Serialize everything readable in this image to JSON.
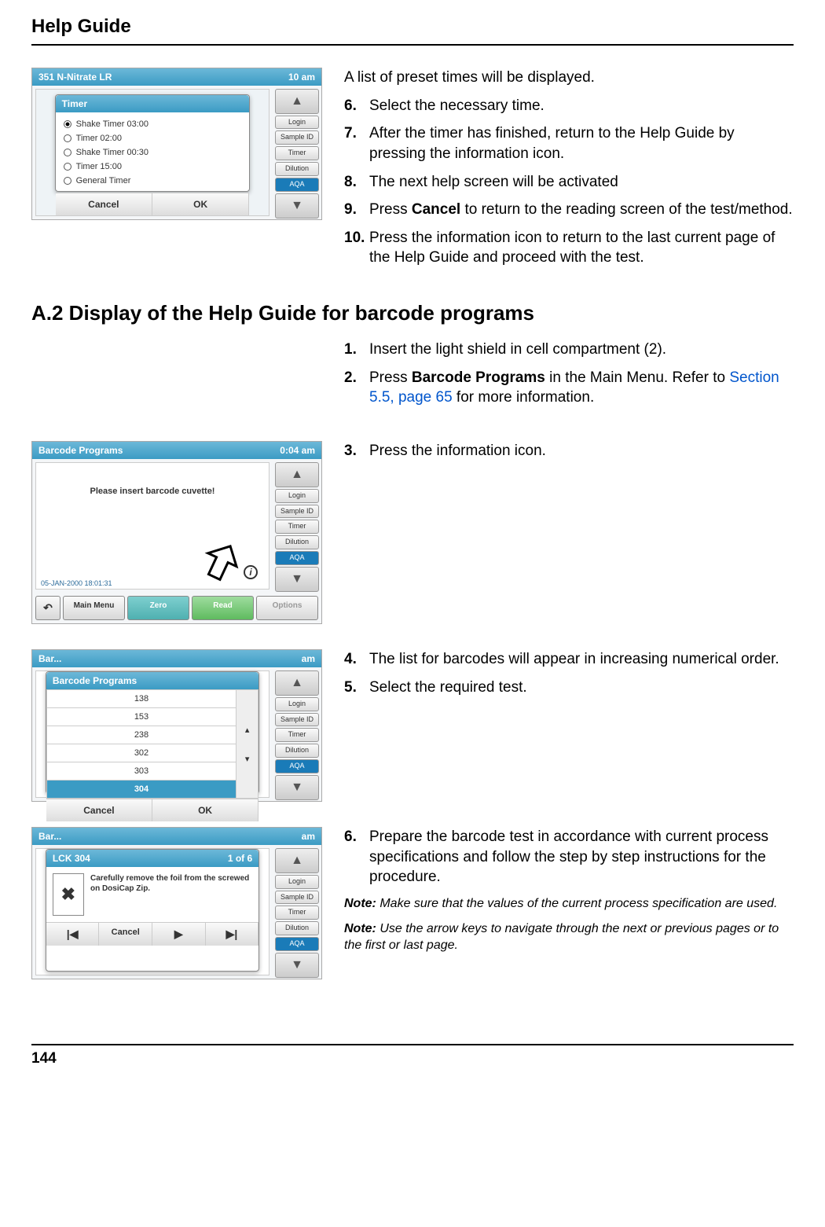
{
  "header": {
    "title": "Help Guide"
  },
  "shot1": {
    "titlebar_left": "351 N-Nitrate LR",
    "titlebar_right": "10 am",
    "dialog_title": "Timer",
    "options": [
      "Shake Timer 03:00",
      "Timer 02:00",
      "Shake Timer 00:30",
      "Timer 15:00",
      "General Timer"
    ],
    "btn_cancel": "Cancel",
    "btn_ok": "OK",
    "side": [
      "Login",
      "Sample ID",
      "Timer",
      "Dilution",
      "AQA"
    ]
  },
  "block1": {
    "intro": "A list of preset times will be displayed.",
    "steps": [
      {
        "n": "6.",
        "t": "Select the necessary time."
      },
      {
        "n": "7.",
        "t": "After the timer has finished, return to the Help Guide by pressing the information icon."
      },
      {
        "n": "8.",
        "t": "The next help screen will be activated"
      },
      {
        "n": "9.",
        "t_pre": "Press ",
        "bold": "Cancel",
        "t_post": " to return to the reading screen of the test/method."
      },
      {
        "n": "10.",
        "t": "Press the information icon to return to the last current page of the Help Guide and proceed with the test."
      }
    ]
  },
  "section2_heading": "A.2  Display of the Help Guide for barcode programs",
  "block2a": {
    "steps": [
      {
        "n": "1.",
        "t": "Insert the light shield in cell compartment (2)."
      },
      {
        "n": "2.",
        "t_pre": "Press ",
        "bold": "Barcode Programs",
        "t_mid": " in the Main Menu. Refer to ",
        "link": "Section 5.5, page 65",
        "t_post": " for more information."
      }
    ]
  },
  "shot2": {
    "titlebar_left": "Barcode Programs",
    "titlebar_right": "0:04 am",
    "msg": "Please insert barcode cuvette!",
    "timestamp": "05-JAN-2000  18:01:31",
    "btn_main": "Main Menu",
    "btn_zero": "Zero",
    "btn_read": "Read",
    "btn_options": "Options",
    "side": [
      "Login",
      "Sample ID",
      "Timer",
      "Dilution",
      "AQA"
    ],
    "info_char": "i"
  },
  "block2b": {
    "steps": [
      {
        "n": "3.",
        "t": "Press the information icon."
      }
    ]
  },
  "shot3": {
    "dialog_title": "Barcode Programs",
    "rows": [
      "138",
      "153",
      "238",
      "302",
      "303",
      "304"
    ],
    "btn_cancel": "Cancel",
    "btn_ok": "OK",
    "side": [
      "Login",
      "Sample ID",
      "Timer",
      "Dilution",
      "AQA"
    ]
  },
  "block3": {
    "steps": [
      {
        "n": "4.",
        "t": "The list for barcodes will appear in increasing numerical order."
      },
      {
        "n": "5.",
        "t": "Select the required test."
      }
    ]
  },
  "shot4": {
    "titlebar_left": "LCK 304",
    "titlebar_right": "1 of 6",
    "img_char": "✖",
    "txt": "Carefully remove the foil from the screwed on DosiCap Zip.",
    "nav_first": "|◀",
    "nav_cancel": "Cancel",
    "nav_play": "▶",
    "nav_last": "▶|",
    "side": [
      "Login",
      "Sample ID",
      "Timer",
      "Dilution",
      "AQA"
    ]
  },
  "block4": {
    "steps": [
      {
        "n": "6.",
        "t": "Prepare the barcode test in accordance with current process specifications and follow the step by step instructions for the procedure."
      }
    ],
    "note1_label": "Note:",
    "note1": " Make sure that the values of the current process specification are used.",
    "note2_label": "Note:",
    "note2": " Use the arrow keys to navigate through the next or previous pages or to the first or last page."
  },
  "page_number": "144"
}
